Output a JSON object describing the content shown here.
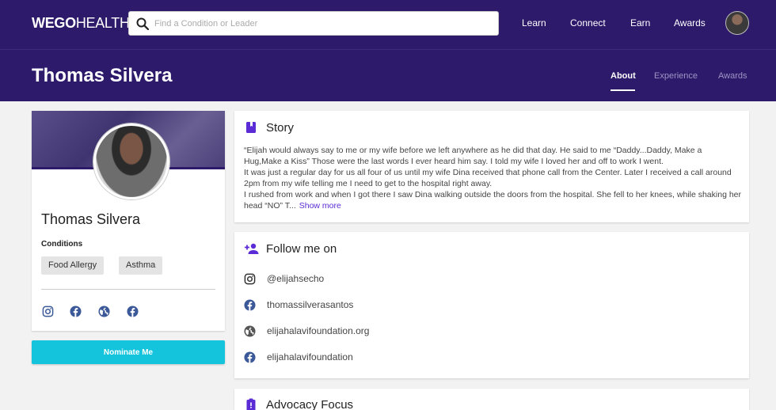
{
  "nav": {
    "logo_bold": "WEGO",
    "logo_thin": "HEALTH",
    "search_placeholder": "Find a Condition or Leader",
    "links": [
      "Learn",
      "Connect",
      "Earn",
      "Awards"
    ]
  },
  "header": {
    "title": "Thomas Silvera",
    "tabs": [
      "About",
      "Experience",
      "Awards"
    ],
    "active_tab": "About"
  },
  "profile": {
    "name": "Thomas Silvera",
    "conditions_label": "Conditions",
    "conditions": [
      "Food Allergy",
      "Asthma"
    ],
    "social_icons": [
      "instagram-icon",
      "facebook-icon",
      "globe-icon",
      "facebook-icon"
    ],
    "nominate_label": "Nominate Me"
  },
  "story": {
    "title": "Story",
    "paragraphs": [
      "“Elijah would always say to me or my wife before we left anywhere as he did that day. He said to me “Daddy...Daddy, Make a Hug,Make a Kiss” Those were the last words I ever heard him say. I told my wife I loved her and off to work I went.",
      "It was just a regular day for us all four of us until my wife Dina received that phone call from the Center. Later I received a call around 2pm from my wife telling me I need to get to the hospital right away.",
      "I rushed from work and when I got there I saw Dina walking outside the doors from the hospital. She fell to her knees, while shaking her head “NO” T..."
    ],
    "show_more": "Show more"
  },
  "follow": {
    "title": "Follow me on",
    "items": [
      {
        "icon": "instagram-icon",
        "label": "@elijahsecho"
      },
      {
        "icon": "facebook-icon",
        "label": "thomassilverasantos"
      },
      {
        "icon": "globe-icon",
        "label": "elijahalavifoundation.org"
      },
      {
        "icon": "facebook-icon",
        "label": "elijahalavifoundation"
      }
    ]
  },
  "advocacy": {
    "title": "Advocacy Focus"
  },
  "colors": {
    "brand_purple": "#2d1a6b",
    "accent_purple": "#5b2bd6",
    "nominate_cyan": "#14c4dc",
    "facebook_blue": "#3b5998"
  }
}
